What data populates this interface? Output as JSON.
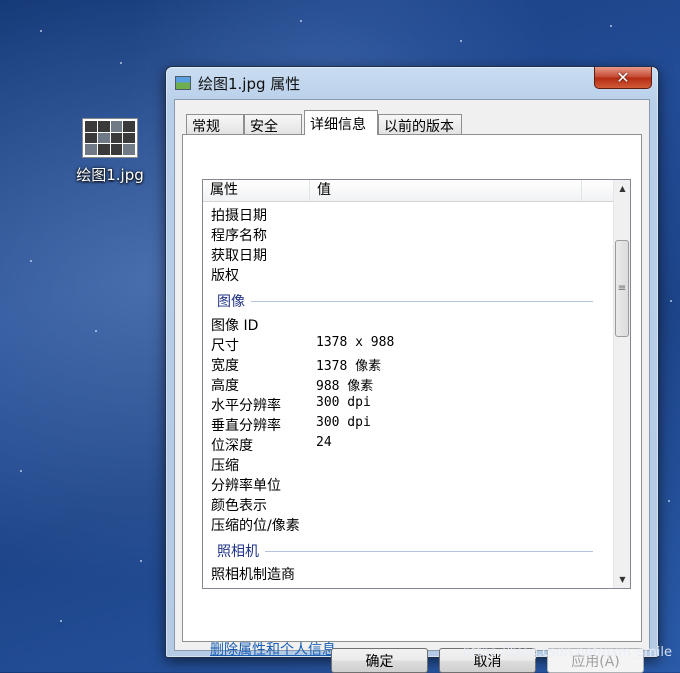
{
  "desktop": {
    "icon_label": "绘图1.jpg"
  },
  "dialog": {
    "title": "绘图1.jpg 属性",
    "close_symbol": "✕",
    "tabs": [
      {
        "label": "常规"
      },
      {
        "label": "安全"
      },
      {
        "label": "详细信息",
        "active": true
      },
      {
        "label": "以前的版本"
      }
    ],
    "list": {
      "header_property": "属性",
      "header_value": "值",
      "rows_top": [
        {
          "k": "拍摄日期",
          "v": ""
        },
        {
          "k": "程序名称",
          "v": ""
        },
        {
          "k": "获取日期",
          "v": ""
        },
        {
          "k": "版权",
          "v": ""
        }
      ],
      "group_image": "图像",
      "rows_image": [
        {
          "k": "图像 ID",
          "v": ""
        },
        {
          "k": "尺寸",
          "v": "1378 x 988"
        },
        {
          "k": "宽度",
          "v": "1378 像素"
        },
        {
          "k": "高度",
          "v": "988 像素"
        },
        {
          "k": "水平分辨率",
          "v": "300 dpi"
        },
        {
          "k": "垂直分辨率",
          "v": "300 dpi"
        },
        {
          "k": "位深度",
          "v": "24"
        },
        {
          "k": "压缩",
          "v": ""
        },
        {
          "k": "分辨率单位",
          "v": ""
        },
        {
          "k": "颜色表示",
          "v": ""
        },
        {
          "k": "压缩的位/像素",
          "v": ""
        }
      ],
      "group_camera": "照相机",
      "rows_camera": [
        {
          "k": "照相机制造商",
          "v": ""
        }
      ]
    },
    "remove_link": "删除属性和个人信息",
    "buttons": {
      "ok": "确定",
      "cancel": "取消",
      "apply": "应用(A)"
    }
  },
  "watermark": "https://blog.csdn.net/qxm_smile",
  "colors": {
    "group_header": "#1e3287",
    "link": "#1a5fb4"
  }
}
